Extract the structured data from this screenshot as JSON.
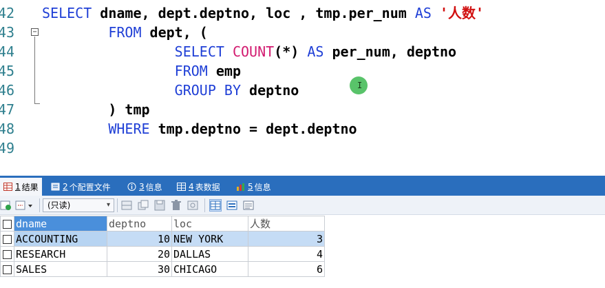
{
  "editor": {
    "lines": [
      {
        "number": "42",
        "segments": [
          {
            "t": "SELECT",
            "c": "kw"
          },
          {
            "t": " dname, dept.deptno, loc , tmp.per_num ",
            "c": ""
          },
          {
            "t": "AS",
            "c": "kw"
          },
          {
            "t": " ",
            "c": ""
          },
          {
            "t": "'人数'",
            "c": "str"
          }
        ]
      },
      {
        "number": "43",
        "segments": [
          {
            "t": "        ",
            "c": ""
          },
          {
            "t": "FROM",
            "c": "kw"
          },
          {
            "t": " dept, (",
            "c": ""
          }
        ]
      },
      {
        "number": "44",
        "segments": [
          {
            "t": "                ",
            "c": ""
          },
          {
            "t": "SELECT",
            "c": "kw"
          },
          {
            "t": " ",
            "c": ""
          },
          {
            "t": "COUNT",
            "c": "fn"
          },
          {
            "t": "(*) ",
            "c": ""
          },
          {
            "t": "AS",
            "c": "kw"
          },
          {
            "t": " per_num, deptno",
            "c": ""
          }
        ]
      },
      {
        "number": "45",
        "segments": [
          {
            "t": "                ",
            "c": ""
          },
          {
            "t": "FROM",
            "c": "kw"
          },
          {
            "t": " emp",
            "c": ""
          }
        ]
      },
      {
        "number": "46",
        "segments": [
          {
            "t": "                ",
            "c": ""
          },
          {
            "t": "GROUP BY",
            "c": "kw"
          },
          {
            "t": " deptno",
            "c": ""
          }
        ]
      },
      {
        "number": "47",
        "segments": [
          {
            "t": "        ",
            "c": ""
          },
          {
            "t": ") tmp",
            "c": ""
          }
        ]
      },
      {
        "number": "48",
        "segments": [
          {
            "t": "        ",
            "c": ""
          },
          {
            "t": "WHERE",
            "c": "kw"
          },
          {
            "t": " tmp.deptno = dept.deptno",
            "c": ""
          }
        ]
      },
      {
        "number": "49",
        "segments": []
      }
    ],
    "fold_glyph": "−",
    "cursor_glyph": "I"
  },
  "tabs": [
    {
      "num": "1",
      "label": "结果",
      "icon": "result-grid-icon",
      "active": true
    },
    {
      "num": "2",
      "label": "个配置文件",
      "icon": "profile-icon",
      "active": false
    },
    {
      "num": "3",
      "label": "信息",
      "icon": "info-icon",
      "active": false
    },
    {
      "num": "4",
      "label": "表数据",
      "icon": "table-data-icon",
      "active": false
    },
    {
      "num": "5",
      "label": "信息",
      "icon": "info-chart-icon",
      "active": false
    }
  ],
  "toolbar": {
    "mode_select": {
      "value": "(只读)",
      "arrow": "▾"
    }
  },
  "grid": {
    "columns": [
      "dname",
      "deptno",
      "loc",
      "人数"
    ],
    "rows": [
      [
        "ACCOUNTING",
        "10",
        "NEW YORK",
        "3"
      ],
      [
        "RESEARCH",
        "20",
        "DALLAS",
        "4"
      ],
      [
        "SALES",
        "30",
        "CHICAGO",
        "6"
      ]
    ]
  },
  "colors": {
    "keyword": "#1f3fd6",
    "function": "#d21a6f",
    "string": "#d11010",
    "line_number": "#2e7f8e",
    "tabbar": "#2a6ebd",
    "selected_header": "#4a8fdb"
  }
}
